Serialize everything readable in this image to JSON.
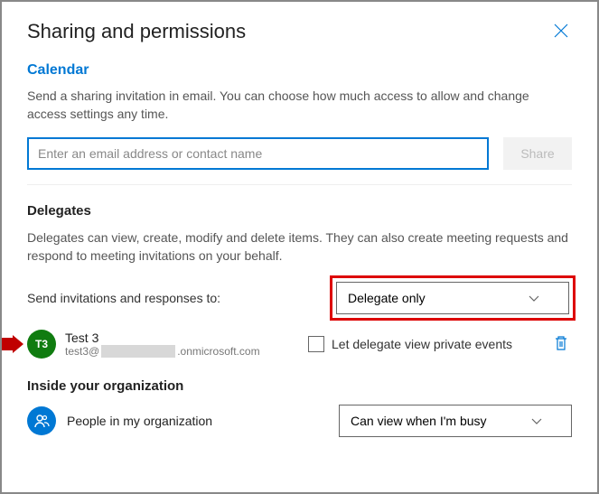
{
  "header": {
    "title": "Sharing and permissions"
  },
  "calendar": {
    "subheading": "Calendar",
    "description": "Send a sharing invitation in email. You can choose how much access to allow and change access settings any time.",
    "input_placeholder": "Enter an email address or contact name",
    "share_button": "Share"
  },
  "delegates": {
    "heading": "Delegates",
    "description": "Delegates can view, create, modify and delete items. They can also create meeting requests and respond to meeting invitations on your behalf.",
    "send_label": "Send invitations and responses to:",
    "send_value": "Delegate only",
    "entry": {
      "initials": "T3",
      "name": "Test 3",
      "email_prefix": "test3@",
      "email_suffix": ".onmicrosoft.com"
    },
    "private_label": "Let delegate view private events"
  },
  "org": {
    "heading": "Inside your organization",
    "label": "People in my organization",
    "permission_value": "Can view when I'm busy"
  }
}
